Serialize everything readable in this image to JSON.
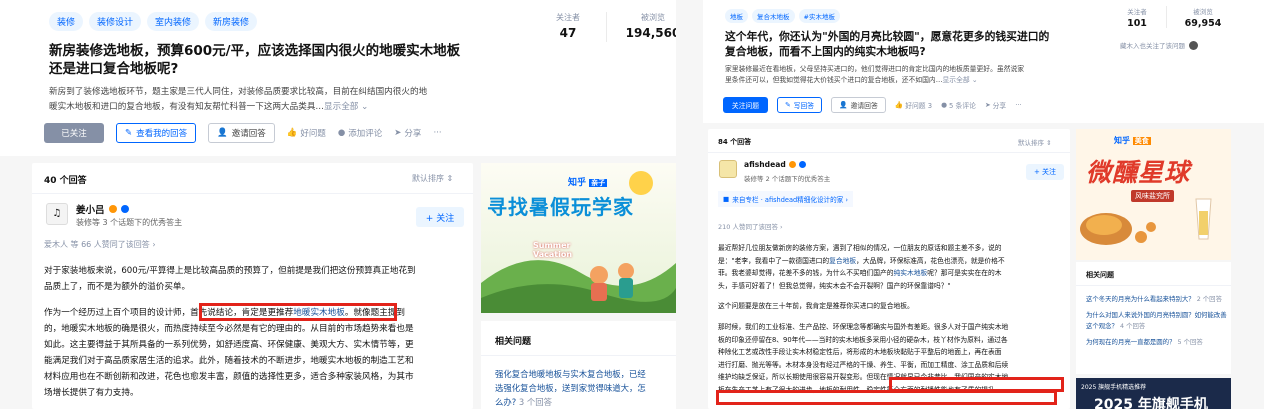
{
  "left": {
    "tags": [
      "装修",
      "装修设计",
      "室内装修",
      "新房装修"
    ],
    "stats": {
      "followers_label": "关注者",
      "followers": "47",
      "views_label": "被浏览",
      "views": "194,560"
    },
    "title_line1": "新房装修选地板，预算600元/平，应该选择国内很火的地暖实木地板",
    "title_line2": "还是进口复合地板呢?",
    "desc_line1": "新房到了装修选地板环节，题主家是三代人同住，对装修品质要求比较高，目前在纠结国内很火的地",
    "desc_line2": "暖实木地板和进口的复合地板，有没有知友帮忙科普一下这两大品类具…",
    "more": "显示全部 ⌄",
    "actions": {
      "followed": "已关注",
      "view_answer": "查看我的回答",
      "invite": "邀请回答",
      "good_q": "好问题",
      "comment": "添加评论",
      "share": "分享",
      "more": "···"
    },
    "answers_count": "40 个回答",
    "sort": "默认排序 ⇕",
    "author_name": "姜小吕",
    "author_desc": "装修等 3 个话题下的优秀答主",
    "follow": "+ 关注",
    "upvote": "爱木人 等 66 人赞同了该回答 ›",
    "p1_l1": "对于家装地板来说，600元/平算得上是比较高品质的预算了，但前提是我们把这份预算真正地花到",
    "p1_l2": "品质上了，而不是为额外的溢价买单。",
    "p2_l1a": "作为一个经历过上百个项目的设计师，",
    "p2_hl_a": "首先说结论，肯定是更推荐",
    "p2_hl_link": "地暖实木地板",
    "p2_hl_b": "。",
    "p2_l1b": "就像题主提到",
    "p2_l2": "的，地暖实木地板的确是很火，而热度持续至今必然是有它的理由的。从目前的市场趋势来看也是",
    "p2_l3": "如此。这主要得益于其所具备的一系列优势，如舒适度高、环保健康、美观大方、实木情节等，更",
    "p2_l4": "能满足我们对于高品质家居生活的追求。此外，随着技术的不断进步，地暖实木地板的制造工艺和",
    "p2_l5": "材料应用也在不断创新和改进，花色也愈发丰富，颜值的选择性更多，适合多种家装风格，为其市",
    "p2_l6": "场增长提供了有力支持。",
    "ad": {
      "brand": "知乎",
      "brand_tag": "亲子",
      "headline": "寻找暑假玩学家",
      "summer": "Summer",
      "vacation": "Vacation"
    },
    "related_title": "相关问题",
    "related_l1": "强化复合地暖地板与实木复合地板，已经",
    "related_l2": "选强化复合地板，送到家觉得味道大，怎",
    "related_l3": "么办?",
    "related_cnt": " 3 个回答"
  },
  "right": {
    "tags": [
      "地板",
      "复合木地板",
      "#实木地板"
    ],
    "stats": {
      "followers_label": "关注者",
      "followers": "101",
      "views_label": "被浏览",
      "views": "69,954"
    },
    "invite_note": "藏木入也关注了该问题",
    "title_line1": "这个年代，你还认为\"外国的月亮比较圆\"，愿意花更多的钱买进口的",
    "title_line2": "复合地板，而看不上国内的纯实木地板吗?",
    "desc_line1": "家里装修最近在看地板，父母坚持买进口的，他们觉得进口的肯定比国内的地板质量更好。虽然说家",
    "desc_line2": "里条件还可以，但我如觉得花大价钱买个进口的复合地板，还不如国内…",
    "more": "显示全部 ⌄",
    "actions": {
      "follow_q": "关注问题",
      "write": "写回答",
      "invite": "邀请回答",
      "good_q": "好问题 3",
      "comment": "5 条评论",
      "share": "分享",
      "more": "···"
    },
    "answers_count": "84 个回答",
    "sort": "默认排序 ⇕",
    "author_name": "afishdead",
    "author_desc": "装修等 2 个话题下的优秀答主",
    "follow": "+ 关注",
    "column": "来自专栏 · afishdead精细化设计的家 ›",
    "upvote": "210 人赞同了该回答 ›",
    "p1_l1": "最近帮好几位朋友做新房的装修方案，遇到了相似的情况，一位朋友的原话和题主差不多，说的",
    "p1_l2a": "是：\"老李，我看中了一款德国进口的",
    "p1_link1": "复合地板",
    "p1_l2b": "，大品牌，环保标准高，花色也漂亮，就是价格不",
    "p1_l3a": "菲。我老婆却觉得，花差不多的钱，为什么不买咱们国产的",
    "p1_link2": "纯实木地板",
    "p1_l3b": "呢？那可是实实在在的木",
    "p1_l4": "头，手感可好着了！但我总觉得，纯实木会不会开裂啊？国产的环保靠谱吗？\"",
    "p2": "这个问题要是放在三十年前，我肯定是推荐你买进口的复合地板。",
    "p3_l1": "那时候，我们的工业标准、生产品控、环保理念等都确实与国外有差距。很多人对于国产纯实木地",
    "p3_l2": "板的印象还停留在8、90年代——当时的实木地板多采用小径的硬杂木，枝丫材作为原料，通过各",
    "p3_l3": "种除化工艺或改性手段让实木材稳定性后，将形成的木地板块黏贴于平整后的地面上，再在表面",
    "p3_l4": "进行打磨、抛光等等。木材本身没有经过严格的干燥、养生、平衡，而加工精度、涂工品质和后续",
    "p3_l5a": "维护均缺乏保证，所以长期使用很容易开裂变形。",
    "p3_hl1": "但现在情况就早已今非昔比，我们国产的实木地",
    "p3_hl2": "板在生产工艺上有了很大的进步，地板的耐用性、稳定性等全方面的耐播性能也有了质的提升。",
    "ad": {
      "brand": "知乎",
      "brand_tag": "美食",
      "headline": "微醺星球",
      "sub": "风味盐究所"
    },
    "related_title": "相关问题",
    "related": [
      {
        "q": "这个冬天的月亮为什么看起来特别大？",
        "cnt": "2 个回答"
      },
      {
        "q": "为什么对国人来说外国的月亮特别圆？如何能改善这个观念？",
        "cnt": "4 个回答"
      },
      {
        "q": "为何现在的月亮一直都是圆的？",
        "cnt": "5 个回答"
      }
    ],
    "ad2_tag": "2025 旗舰手机精选推荐",
    "ad2_headline": "2025 年旗舰手机"
  },
  "colors": {
    "brand": "#0066ff",
    "highlight": "#e2231a",
    "muted": "#8590a6",
    "link": "#175199"
  }
}
